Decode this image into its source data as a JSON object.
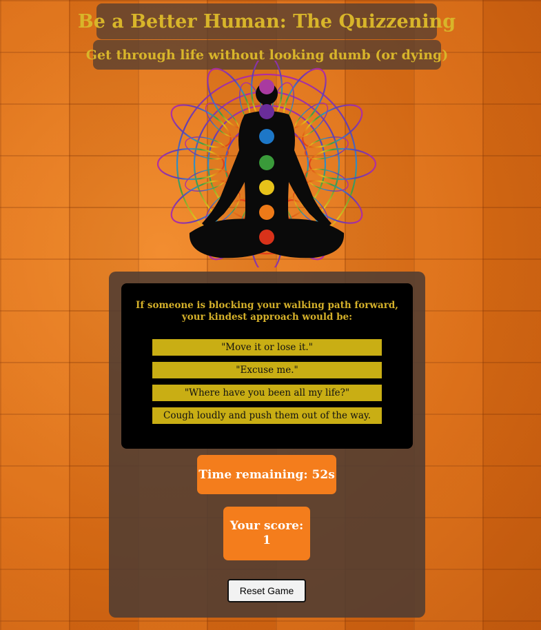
{
  "header": {
    "title": "Be a Better Human: The Quizzening",
    "subtitle": "Get through life without looking dumb (or dying)"
  },
  "hero_image": {
    "icon": "meditation-chakra-mandala-icon"
  },
  "quiz": {
    "question": "If someone is blocking your walking path forward, your kindest approach would be:",
    "answers": [
      "\"Move it or lose it.\"",
      "\"Excuse me.\"",
      "\"Where have you been all my life?\"",
      "Cough loudly and push them out of the way."
    ]
  },
  "timer": {
    "label": "Time remaining: 52s"
  },
  "score": {
    "label": "Your score:",
    "value": "1"
  },
  "controls": {
    "reset_label": "Reset Game"
  },
  "colors": {
    "accent_gold": "#d8b52a",
    "answer_bg": "#c9ae14",
    "orange_button": "#f47d1c",
    "panel": "#50403a"
  }
}
